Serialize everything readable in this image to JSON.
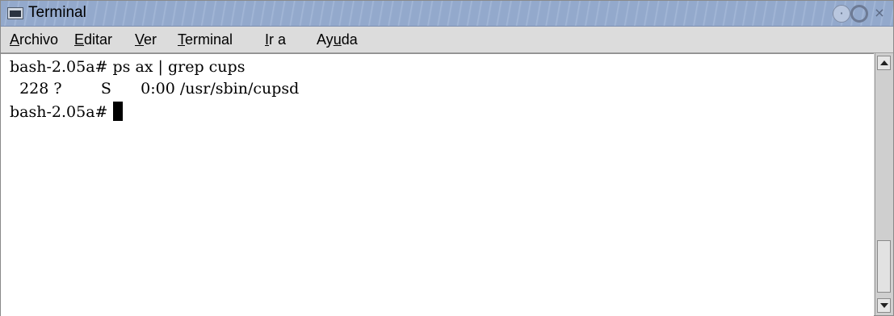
{
  "window": {
    "title": "Terminal",
    "icons": {
      "app": "terminal-icon",
      "minimize": "minimize-icon",
      "maximize": "maximize-icon",
      "close": "close-icon"
    }
  },
  "menu": {
    "items": [
      {
        "mnemonic": "A",
        "rest": "rchivo",
        "label": "Archivo"
      },
      {
        "mnemonic": "E",
        "rest": "ditar",
        "label": "Editar"
      },
      {
        "mnemonic": "V",
        "rest": "er",
        "label": "Ver"
      },
      {
        "mnemonic": "T",
        "rest": "erminal",
        "label": "Terminal"
      },
      {
        "mnemonic": "I",
        "rest": "r a",
        "label": "Ir a"
      },
      {
        "pre": "Ay",
        "mnemonic": "u",
        "rest": "da",
        "label": "Ayuda"
      }
    ]
  },
  "terminal": {
    "lines": [
      "bash-2.05a# ps ax | grep cups",
      "  228 ?        S      0:00 /usr/sbin/cupsd",
      "bash-2.05a# "
    ]
  },
  "scrollbar": {
    "position": 1.0,
    "icons": {
      "up": "arrow-up-icon",
      "down": "arrow-down-icon"
    }
  },
  "colors": {
    "titlebar": "#93a9cc",
    "terminal_bg": "#ffffff",
    "terminal_fg": "#000000"
  }
}
